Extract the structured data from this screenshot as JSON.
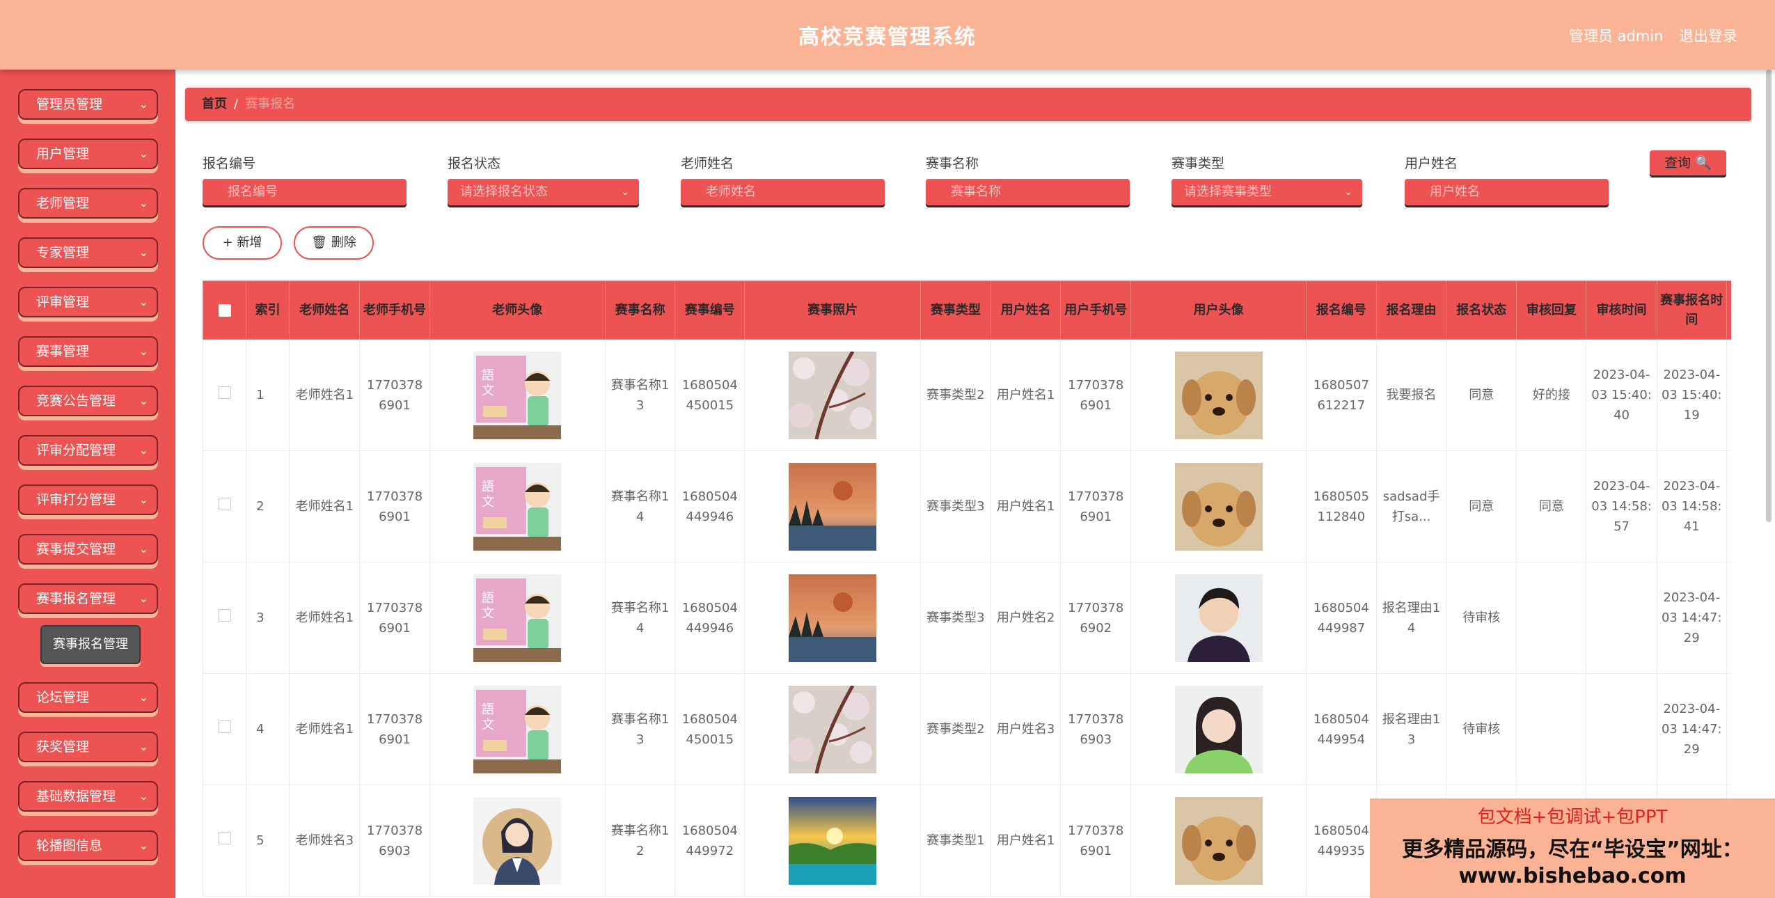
{
  "header": {
    "title": "高校竞赛管理系统",
    "user": "管理员 admin",
    "logout": "退出登录"
  },
  "sidebar": {
    "items": [
      {
        "label": "管理员管理"
      },
      {
        "label": "用户管理"
      },
      {
        "label": "老师管理"
      },
      {
        "label": "专家管理"
      },
      {
        "label": "评审管理"
      },
      {
        "label": "赛事管理"
      },
      {
        "label": "竞赛公告管理"
      },
      {
        "label": "评审分配管理"
      },
      {
        "label": "评审打分管理"
      },
      {
        "label": "赛事提交管理"
      },
      {
        "label": "赛事报名管理"
      },
      {
        "label": "论坛管理"
      },
      {
        "label": "获奖管理"
      },
      {
        "label": "基础数据管理"
      },
      {
        "label": "轮播图信息"
      }
    ],
    "sub_item": "赛事报名管理",
    "chevron": "⌄"
  },
  "breadcrumb": {
    "home": "首页",
    "separator": "/",
    "current": "赛事报名"
  },
  "search": {
    "fields": [
      {
        "label": "报名编号",
        "placeholder": "报名编号"
      },
      {
        "label": "报名状态",
        "placeholder": "请选择报名状态"
      },
      {
        "label": "老师姓名",
        "placeholder": "老师姓名"
      },
      {
        "label": "赛事名称",
        "placeholder": "赛事名称"
      },
      {
        "label": "赛事类型",
        "placeholder": "请选择赛事类型"
      },
      {
        "label": "用户姓名",
        "placeholder": "用户姓名"
      }
    ],
    "query_button": "查询 🔍"
  },
  "actions": {
    "add": "+ 新增",
    "delete": "🗑 删除"
  },
  "table": {
    "headers": [
      "索引",
      "老师姓名",
      "老师手机号",
      "老师头像",
      "赛事名称",
      "赛事编号",
      "赛事照片",
      "赛事类型",
      "用户姓名",
      "用户手机号",
      "用户头像",
      "报名编号",
      "报名理由",
      "报名状态",
      "审核回复",
      "审核时间",
      "赛事报名时间"
    ],
    "rows": [
      {
        "index": "1",
        "teacher_name": "老师姓名1",
        "teacher_phone": "17703786901",
        "teacher_avatar": "teacher-cartoon",
        "event_name": "赛事名称13",
        "event_code": "1680504450015",
        "event_photo": "blossom",
        "event_type": "赛事类型2",
        "user_name": "用户姓名1",
        "user_phone": "17703786901",
        "user_avatar": "puppy",
        "signup_code": "1680507612217",
        "reason": "我要报名",
        "status": "同意",
        "reply": "好的接",
        "review_time": "2023-04-03 15:40:40",
        "signup_time": "2023-04-03 15:40:19"
      },
      {
        "index": "2",
        "teacher_name": "老师姓名1",
        "teacher_phone": "17703786901",
        "teacher_avatar": "teacher-cartoon",
        "event_name": "赛事名称14",
        "event_code": "1680504449946",
        "event_photo": "eclipse-lake",
        "event_type": "赛事类型3",
        "user_name": "用户姓名1",
        "user_phone": "17703786901",
        "user_avatar": "puppy",
        "signup_code": "1680505112840",
        "reason": "sadsad手打sa...",
        "status": "同意",
        "reply": "同意",
        "review_time": "2023-04-03 14:58:57",
        "signup_time": "2023-04-03 14:58:41"
      },
      {
        "index": "3",
        "teacher_name": "老师姓名1",
        "teacher_phone": "17703786901",
        "teacher_avatar": "teacher-cartoon",
        "event_name": "赛事名称14",
        "event_code": "1680504449946",
        "event_photo": "eclipse-lake",
        "event_type": "赛事类型3",
        "user_name": "用户姓名2",
        "user_phone": "17703786902",
        "user_avatar": "young-man",
        "signup_code": "1680504449987",
        "reason": "报名理由14",
        "status": "待审核",
        "reply": "",
        "review_time": "",
        "signup_time": "2023-04-03 14:47:29"
      },
      {
        "index": "4",
        "teacher_name": "老师姓名1",
        "teacher_phone": "17703786901",
        "teacher_avatar": "teacher-cartoon",
        "event_name": "赛事名称13",
        "event_code": "1680504450015",
        "event_photo": "blossom",
        "event_type": "赛事类型2",
        "user_name": "用户姓名3",
        "user_phone": "17703786903",
        "user_avatar": "girl-green",
        "signup_code": "1680504449954",
        "reason": "报名理由13",
        "status": "待审核",
        "reply": "",
        "review_time": "",
        "signup_time": "2023-04-03 14:47:29"
      },
      {
        "index": "5",
        "teacher_name": "老师姓名3",
        "teacher_phone": "17703786903",
        "teacher_avatar": "teacher-woman",
        "event_name": "赛事名称12",
        "event_code": "1680504449972",
        "event_photo": "sunset-lake",
        "event_type": "赛事类型1",
        "user_name": "用户姓名1",
        "user_phone": "17703786901",
        "user_avatar": "puppy",
        "signup_code": "1680504449935",
        "reason": "",
        "status": "",
        "reply": "",
        "review_time": "",
        "signup_time": ""
      }
    ]
  },
  "ad": {
    "line1": "包文档+包调试+包PPT",
    "line2": "更多精品源码，尽在“毕设宝”网址：",
    "line3": "www.bishebao.com"
  },
  "colors": {
    "header": "#fbb395",
    "accent": "#ee5353",
    "sidebar_shadow": "#f6b49a",
    "text_dark": "#2a2a2a"
  }
}
